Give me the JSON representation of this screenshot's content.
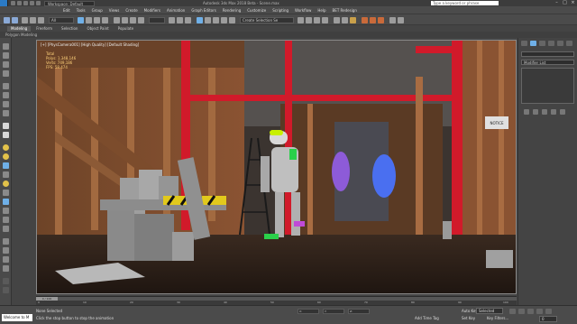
{
  "titlebar": {
    "workspace": "Workspace: Default",
    "document": "Autodesk 3ds Max 2018  Beta - Scene.max",
    "search_placeholder": "Type a keyword or phrase"
  },
  "menubar": {
    "items": [
      "Edit",
      "Tools",
      "Group",
      "Views",
      "Create",
      "Modifiers",
      "Animation",
      "Graph Editors",
      "Rendering",
      "Customize",
      "Scripting",
      "Workflow",
      "Help",
      "BET Redesign"
    ]
  },
  "toolbar": {
    "filter_value": "All",
    "selection_set_value": "Create Selection Se"
  },
  "ribbon": {
    "tabs": [
      "Modeling",
      "Freeform",
      "Selection",
      "Object Paint",
      "Populate"
    ],
    "active_tab": "Modeling",
    "subribbon_label": "Polygon Modeling"
  },
  "viewport": {
    "label": "[+] [PhysCamera001] [High Quality] [Default Shading]",
    "stats": {
      "total_label": "Total",
      "polys": "Polys: 1,348,146",
      "verts": "Verts: 749,186",
      "fps": "FPS: 58.474"
    },
    "sign_text": "NOTICE"
  },
  "rightpanel": {
    "modifier_list": "Modifier List"
  },
  "timeline": {
    "thumb": "0 / 100",
    "ticks": [
      "0",
      "10",
      "20",
      "30",
      "40",
      "50",
      "60",
      "70",
      "80",
      "90",
      "100"
    ]
  },
  "status": {
    "maxscript_mini": "Welcome to M",
    "selection_status": "None Selected",
    "prompt": "Click the stop button to stop the animation",
    "coord_x": "X:",
    "coord_y": "Y:",
    "coord_z": "Z:",
    "add_time_tag": "Add Time Tag",
    "auto_key": "Auto Key",
    "selected": "Selected",
    "set_key": "Set Key",
    "key_filters": "Key Filters...",
    "frame": "0"
  },
  "colors": {
    "accent": "#2b7ac4",
    "beam_red": "#d11a2a",
    "wood": "#8a5332",
    "floor": "#2a1d16",
    "neon_green": "#c8f000",
    "blue_tree": "#4a6ff0",
    "purple_tree": "#8d5bd8"
  }
}
